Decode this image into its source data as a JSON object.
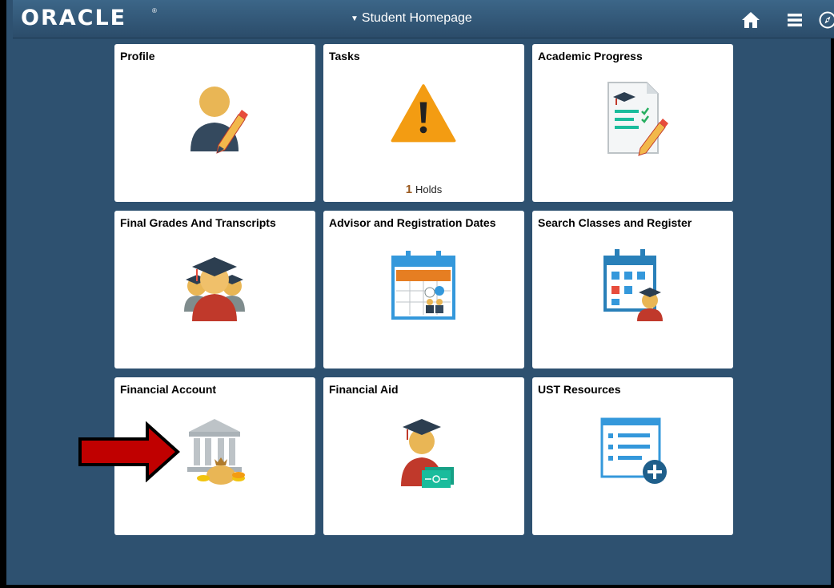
{
  "header": {
    "logo": "ORACLE",
    "logo_mark": "®",
    "page_selector_label": "Student Homepage",
    "icons": [
      "home-icon",
      "actions-menu-icon",
      "navbar-icon"
    ]
  },
  "tiles": [
    {
      "title": "Profile",
      "icon": "profile-icon"
    },
    {
      "title": "Tasks",
      "icon": "warning-icon",
      "badge_count": "1",
      "badge_label": "Holds"
    },
    {
      "title": "Academic Progress",
      "icon": "academic-progress-icon"
    },
    {
      "title": "Final Grades And Transcripts",
      "icon": "graduates-icon"
    },
    {
      "title": "Advisor and Registration Dates",
      "icon": "calendar-advisor-icon"
    },
    {
      "title": "Search Classes and Register",
      "icon": "class-calendar-icon"
    },
    {
      "title": "Financial Account",
      "icon": "bank-icon"
    },
    {
      "title": "Financial Aid",
      "icon": "graduate-money-icon"
    },
    {
      "title": "UST Resources",
      "icon": "resource-list-icon"
    }
  ],
  "annotation": {
    "icon": "red-arrow-icon",
    "color": "#c00000"
  },
  "colors": {
    "background": "#2e5170",
    "banner": "#3a6486",
    "tile": "#ffffff",
    "warning": "#f39c12"
  }
}
